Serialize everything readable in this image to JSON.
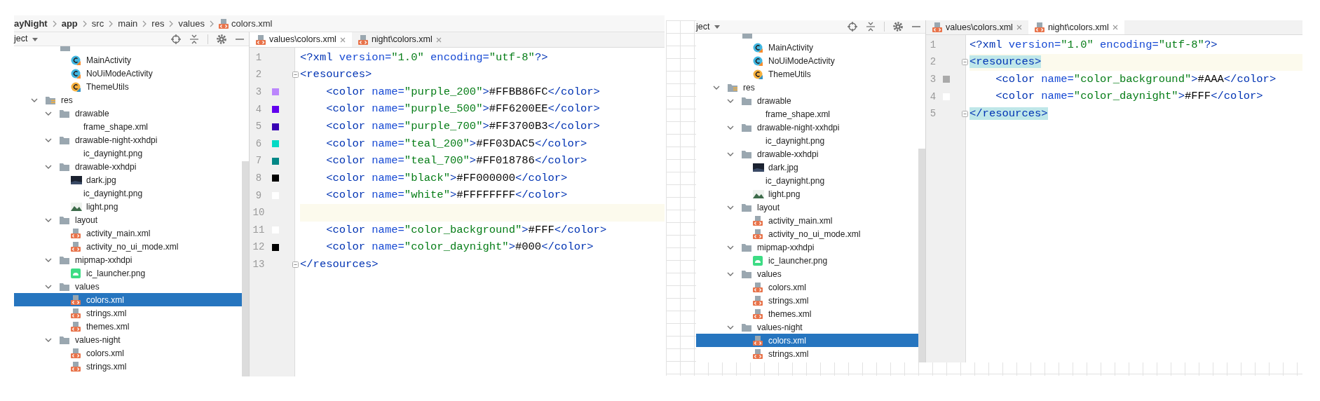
{
  "screenshots": [
    {
      "breadcrumb": [
        {
          "kind": "folder",
          "text": "ayNight",
          "bold": true
        },
        {
          "kind": "folder",
          "text": "app",
          "bold": true
        },
        {
          "kind": "folder",
          "text": "src",
          "bold": false
        },
        {
          "kind": "folder",
          "text": "main",
          "bold": false
        },
        {
          "kind": "folder",
          "text": "res",
          "bold": false
        },
        {
          "kind": "folder",
          "text": "values",
          "bold": false
        },
        {
          "kind": "file",
          "text": "colors.xml",
          "bold": false
        }
      ],
      "panel": {
        "title": "ject"
      },
      "tree": [
        {
          "kind": "package",
          "selected": false,
          "children": [
            {
              "kind": "class",
              "label": "MainActivity",
              "selected": false
            },
            {
              "kind": "class",
              "label": "NoUiModeActivity",
              "selected": false
            },
            {
              "kind": "util",
              "label": "ThemeUtils",
              "selected": false
            }
          ]
        },
        {
          "kind": "res",
          "label": "res",
          "expanded": true,
          "selected": false,
          "children": [
            {
              "kind": "folder",
              "label": "drawable",
              "expanded": true,
              "selected": false,
              "children": [
                {
                  "kind": "plain",
                  "label": "frame_shape.xml",
                  "selected": false
                }
              ]
            },
            {
              "kind": "folder",
              "label": "drawable-night-xxhdpi",
              "expanded": true,
              "selected": false,
              "children": [
                {
                  "kind": "plain",
                  "label": "ic_daynight.png",
                  "selected": false
                }
              ]
            },
            {
              "kind": "folder",
              "label": "drawable-xxhdpi",
              "expanded": true,
              "selected": false,
              "children": [
                {
                  "kind": "jpg",
                  "label": "dark.jpg",
                  "selected": false
                },
                {
                  "kind": "plain",
                  "label": "ic_daynight.png",
                  "selected": false
                },
                {
                  "kind": "png",
                  "label": "light.png",
                  "selected": false
                }
              ]
            },
            {
              "kind": "folder",
              "label": "layout",
              "expanded": true,
              "selected": false,
              "children": [
                {
                  "kind": "xml",
                  "label": "activity_main.xml",
                  "selected": false
                },
                {
                  "kind": "xml",
                  "label": "activity_no_ui_mode.xml",
                  "selected": false
                }
              ]
            },
            {
              "kind": "folder",
              "label": "mipmap-xxhdpi",
              "expanded": true,
              "selected": false,
              "children": [
                {
                  "kind": "launcher",
                  "label": "ic_launcher.png",
                  "selected": false
                }
              ]
            },
            {
              "kind": "folder",
              "label": "values",
              "expanded": true,
              "selected": false,
              "children": [
                {
                  "kind": "xml",
                  "label": "colors.xml",
                  "selected": true
                },
                {
                  "kind": "xml",
                  "label": "strings.xml",
                  "selected": false
                },
                {
                  "kind": "xml",
                  "label": "themes.xml",
                  "selected": false
                }
              ]
            },
            {
              "kind": "folder",
              "label": "values-night",
              "expanded": true,
              "selected": false,
              "children": [
                {
                  "kind": "xml",
                  "label": "colors.xml",
                  "selected": false
                },
                {
                  "kind": "xml",
                  "label": "strings.xml",
                  "selected": false
                }
              ]
            }
          ]
        }
      ],
      "tabs": [
        {
          "label": "values\\colors.xml",
          "selected": true
        },
        {
          "label": "night\\colors.xml",
          "selected": false
        }
      ],
      "editor": {
        "lines": [
          {
            "number": "1",
            "current": false,
            "fold": false,
            "matched": false,
            "tokens": [
              {
                "kind": "pi",
                "text": "<?xml"
              },
              {
                "kind": "attr",
                "text": " version="
              },
              {
                "kind": "string",
                "text": "\"1.0\""
              },
              {
                "kind": "attr",
                "text": " encoding="
              },
              {
                "kind": "string",
                "text": "\"utf-8\""
              },
              {
                "kind": "pi",
                "text": "?>"
              }
            ]
          },
          {
            "number": "2",
            "current": false,
            "fold": true,
            "matched": false,
            "tokens": [
              {
                "kind": "tag",
                "text": "<resources>"
              }
            ]
          },
          {
            "number": "3",
            "current": false,
            "fold": false,
            "matched": false,
            "color": "#bb86fc",
            "tokens": [
              {
                "kind": "tag",
                "text": "    <color"
              },
              {
                "kind": "attr",
                "text": " name="
              },
              {
                "kind": "string",
                "text": "\"purple_200\""
              },
              {
                "kind": "tag",
                "text": ">"
              },
              {
                "kind": "text",
                "text": "#FFBB86FC"
              },
              {
                "kind": "tag",
                "text": "</color>"
              }
            ]
          },
          {
            "number": "4",
            "current": false,
            "fold": false,
            "matched": false,
            "color": "#6200ee",
            "tokens": [
              {
                "kind": "tag",
                "text": "    <color"
              },
              {
                "kind": "attr",
                "text": " name="
              },
              {
                "kind": "string",
                "text": "\"purple_500\""
              },
              {
                "kind": "tag",
                "text": ">"
              },
              {
                "kind": "text",
                "text": "#FF6200EE"
              },
              {
                "kind": "tag",
                "text": "</color>"
              }
            ]
          },
          {
            "number": "5",
            "current": false,
            "fold": false,
            "matched": false,
            "color": "#3700b3",
            "tokens": [
              {
                "kind": "tag",
                "text": "    <color"
              },
              {
                "kind": "attr",
                "text": " name="
              },
              {
                "kind": "string",
                "text": "\"purple_700\""
              },
              {
                "kind": "tag",
                "text": ">"
              },
              {
                "kind": "text",
                "text": "#FF3700B3"
              },
              {
                "kind": "tag",
                "text": "</color>"
              }
            ]
          },
          {
            "number": "6",
            "current": false,
            "fold": false,
            "matched": false,
            "color": "#03dac5",
            "tokens": [
              {
                "kind": "tag",
                "text": "    <color"
              },
              {
                "kind": "attr",
                "text": " name="
              },
              {
                "kind": "string",
                "text": "\"teal_200\""
              },
              {
                "kind": "tag",
                "text": ">"
              },
              {
                "kind": "text",
                "text": "#FF03DAC5"
              },
              {
                "kind": "tag",
                "text": "</color>"
              }
            ]
          },
          {
            "number": "7",
            "current": false,
            "fold": false,
            "matched": false,
            "color": "#018786",
            "tokens": [
              {
                "kind": "tag",
                "text": "    <color"
              },
              {
                "kind": "attr",
                "text": " name="
              },
              {
                "kind": "string",
                "text": "\"teal_700\""
              },
              {
                "kind": "tag",
                "text": ">"
              },
              {
                "kind": "text",
                "text": "#FF018786"
              },
              {
                "kind": "tag",
                "text": "</color>"
              }
            ]
          },
          {
            "number": "8",
            "current": false,
            "fold": false,
            "matched": false,
            "color": "#000000",
            "tokens": [
              {
                "kind": "tag",
                "text": "    <color"
              },
              {
                "kind": "attr",
                "text": " name="
              },
              {
                "kind": "string",
                "text": "\"black\""
              },
              {
                "kind": "tag",
                "text": ">"
              },
              {
                "kind": "text",
                "text": "#FF000000"
              },
              {
                "kind": "tag",
                "text": "</color>"
              }
            ]
          },
          {
            "number": "9",
            "current": false,
            "fold": false,
            "matched": false,
            "color": "#ffffff",
            "tokens": [
              {
                "kind": "tag",
                "text": "    <color"
              },
              {
                "kind": "attr",
                "text": " name="
              },
              {
                "kind": "string",
                "text": "\"white\""
              },
              {
                "kind": "tag",
                "text": ">"
              },
              {
                "kind": "text",
                "text": "#FFFFFFFF"
              },
              {
                "kind": "tag",
                "text": "</color>"
              }
            ]
          },
          {
            "number": "10",
            "current": true,
            "fold": false,
            "matched": false
          },
          {
            "number": "11",
            "current": false,
            "fold": false,
            "matched": false,
            "color": "#ffffff",
            "tokens": [
              {
                "kind": "tag",
                "text": "    <color"
              },
              {
                "kind": "attr",
                "text": " name="
              },
              {
                "kind": "string",
                "text": "\"color_background\""
              },
              {
                "kind": "tag",
                "text": ">"
              },
              {
                "kind": "text",
                "text": "#FFF"
              },
              {
                "kind": "tag",
                "text": "</color>"
              }
            ]
          },
          {
            "number": "12",
            "current": false,
            "fold": false,
            "matched": false,
            "color": "#000000",
            "tokens": [
              {
                "kind": "tag",
                "text": "    <color"
              },
              {
                "kind": "attr",
                "text": " name="
              },
              {
                "kind": "string",
                "text": "\"color_daynight\""
              },
              {
                "kind": "tag",
                "text": ">"
              },
              {
                "kind": "text",
                "text": "#000"
              },
              {
                "kind": "tag",
                "text": "</color>"
              }
            ]
          },
          {
            "number": "13",
            "current": false,
            "fold": true,
            "matched": false,
            "tokens": [
              {
                "kind": "tag",
                "text": "</resources>"
              }
            ]
          }
        ]
      }
    },
    {
      "panel": {
        "title": "ject"
      },
      "tree": [
        {
          "kind": "package",
          "selected": false,
          "children": [
            {
              "kind": "class",
              "label": "MainActivity",
              "selected": false
            },
            {
              "kind": "class",
              "label": "NoUiModeActivity",
              "selected": false
            },
            {
              "kind": "util",
              "label": "ThemeUtils",
              "selected": false
            }
          ]
        },
        {
          "kind": "res",
          "label": "res",
          "expanded": true,
          "selected": false,
          "children": [
            {
              "kind": "folder",
              "label": "drawable",
              "expanded": true,
              "selected": false,
              "children": [
                {
                  "kind": "plain",
                  "label": "frame_shape.xml",
                  "selected": false
                }
              ]
            },
            {
              "kind": "folder",
              "label": "drawable-night-xxhdpi",
              "expanded": true,
              "selected": false,
              "children": [
                {
                  "kind": "plain",
                  "label": "ic_daynight.png",
                  "selected": false
                }
              ]
            },
            {
              "kind": "folder",
              "label": "drawable-xxhdpi",
              "expanded": true,
              "selected": false,
              "children": [
                {
                  "kind": "jpg",
                  "label": "dark.jpg",
                  "selected": false
                },
                {
                  "kind": "plain",
                  "label": "ic_daynight.png",
                  "selected": false
                },
                {
                  "kind": "png",
                  "label": "light.png",
                  "selected": false
                }
              ]
            },
            {
              "kind": "folder",
              "label": "layout",
              "expanded": true,
              "selected": false,
              "children": [
                {
                  "kind": "xml",
                  "label": "activity_main.xml",
                  "selected": false
                },
                {
                  "kind": "xml",
                  "label": "activity_no_ui_mode.xml",
                  "selected": false
                }
              ]
            },
            {
              "kind": "folder",
              "label": "mipmap-xxhdpi",
              "expanded": true,
              "selected": false,
              "children": [
                {
                  "kind": "launcher",
                  "label": "ic_launcher.png",
                  "selected": false
                }
              ]
            },
            {
              "kind": "folder",
              "label": "values",
              "expanded": true,
              "selected": false,
              "children": [
                {
                  "kind": "xml",
                  "label": "colors.xml",
                  "selected": false
                },
                {
                  "kind": "xml",
                  "label": "strings.xml",
                  "selected": false
                },
                {
                  "kind": "xml",
                  "label": "themes.xml",
                  "selected": false
                }
              ]
            },
            {
              "kind": "folder",
              "label": "values-night",
              "expanded": true,
              "selected": false,
              "children": [
                {
                  "kind": "xml",
                  "label": "colors.xml",
                  "selected": true
                },
                {
                  "kind": "xml",
                  "label": "strings.xml",
                  "selected": false
                }
              ]
            }
          ]
        }
      ],
      "tabs": [
        {
          "label": "values\\colors.xml",
          "selected": false
        },
        {
          "label": "night\\colors.xml",
          "selected": true
        }
      ],
      "editor": {
        "lines": [
          {
            "number": "1",
            "current": false,
            "fold": false,
            "matched": false,
            "tokens": [
              {
                "kind": "pi",
                "text": "<?xml"
              },
              {
                "kind": "attr",
                "text": " version="
              },
              {
                "kind": "string",
                "text": "\"1.0\""
              },
              {
                "kind": "attr",
                "text": " encoding="
              },
              {
                "kind": "string",
                "text": "\"utf-8\""
              },
              {
                "kind": "pi",
                "text": "?>"
              }
            ]
          },
          {
            "number": "2",
            "current": true,
            "fold": true,
            "matched": true,
            "tokens": [
              {
                "kind": "tag",
                "text": "<resources>"
              }
            ]
          },
          {
            "number": "3",
            "current": false,
            "fold": false,
            "matched": false,
            "color": "#aaaaaa",
            "tokens": [
              {
                "kind": "tag",
                "text": "    <color"
              },
              {
                "kind": "attr",
                "text": " name="
              },
              {
                "kind": "string",
                "text": "\"color_background\""
              },
              {
                "kind": "tag",
                "text": ">"
              },
              {
                "kind": "text",
                "text": "#AAA"
              },
              {
                "kind": "tag",
                "text": "</color>"
              }
            ]
          },
          {
            "number": "4",
            "current": false,
            "fold": false,
            "matched": false,
            "color": "#ffffff",
            "tokens": [
              {
                "kind": "tag",
                "text": "    <color"
              },
              {
                "kind": "attr",
                "text": " name="
              },
              {
                "kind": "string",
                "text": "\"color_daynight\""
              },
              {
                "kind": "tag",
                "text": ">"
              },
              {
                "kind": "text",
                "text": "#FFF"
              },
              {
                "kind": "tag",
                "text": "</color>"
              }
            ]
          },
          {
            "number": "5",
            "current": false,
            "fold": true,
            "matched": true,
            "tokens": [
              {
                "kind": "tag",
                "text": "</resources>"
              }
            ]
          }
        ]
      }
    }
  ]
}
